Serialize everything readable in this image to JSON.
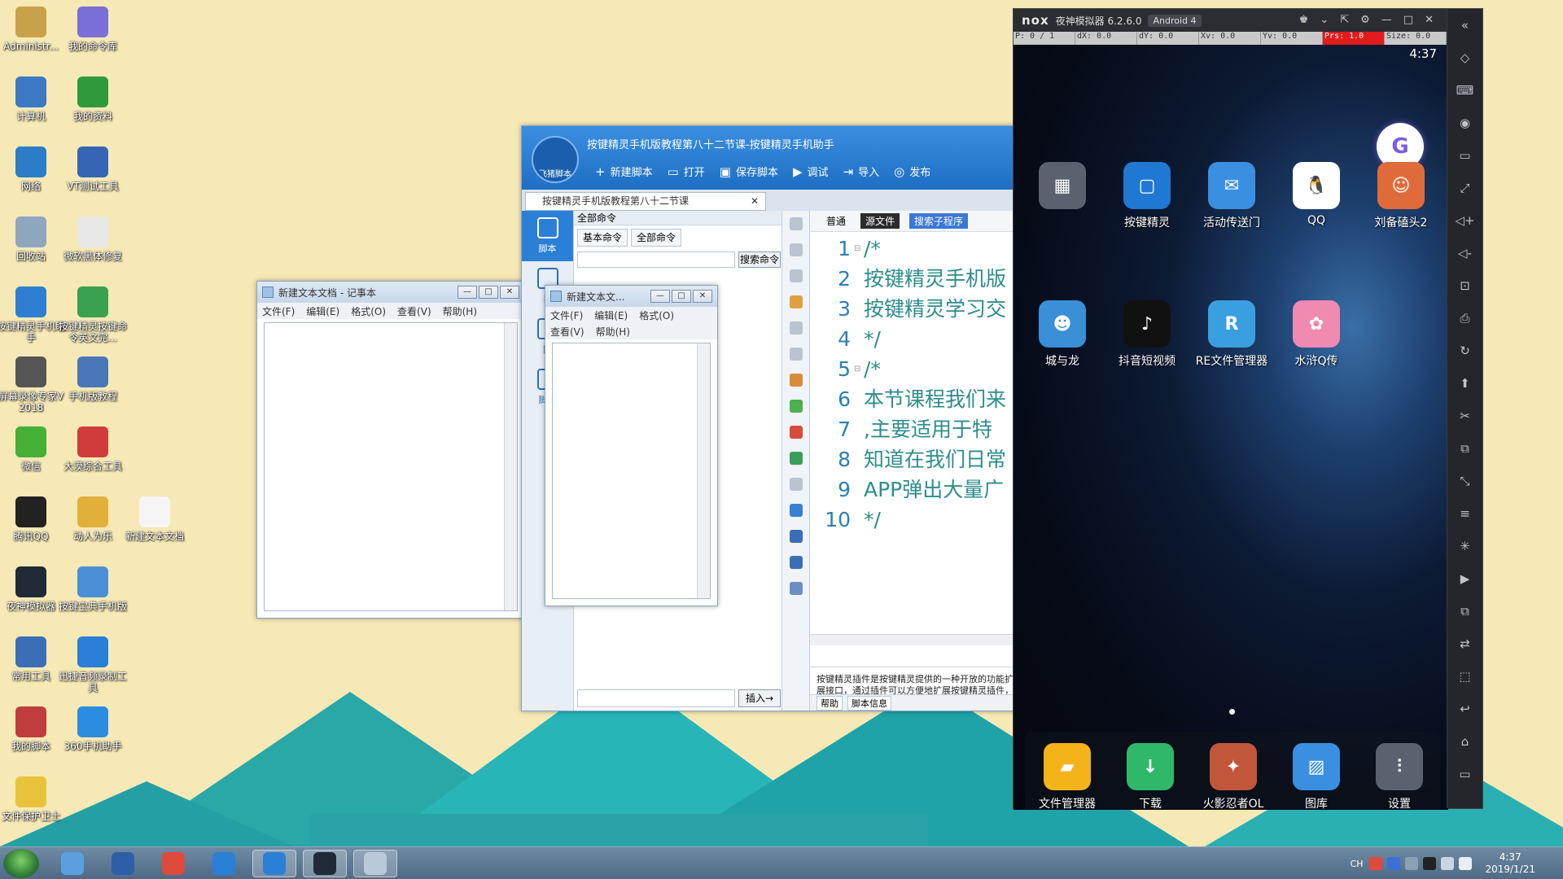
{
  "desktop": {
    "icons": [
      {
        "label": "Administr...",
        "color": "#c9a14a"
      },
      {
        "label": "我的命令库",
        "color": "#7a6fd6"
      },
      {
        "label": "计算机",
        "color": "#3d79c5"
      },
      {
        "label": "我的资料",
        "color": "#2f9a3b"
      },
      {
        "label": "网络",
        "color": "#2b7cc9"
      },
      {
        "label": "VT测试工具",
        "color": "#3566b5"
      },
      {
        "label": "回收站",
        "color": "#8fa6bf"
      },
      {
        "label": "微软黑体修复",
        "color": "#e8e8e8"
      },
      {
        "label": "按键精灵手机助手",
        "color": "#2e7fd1"
      },
      {
        "label": "按键精灵按键命令英文完...",
        "color": "#3aa14f"
      },
      {
        "label": "屏幕录像专家V2018",
        "color": "#555555"
      },
      {
        "label": "手机版教程",
        "color": "#4a77b8"
      },
      {
        "label": "微信",
        "color": "#45b035"
      },
      {
        "label": "大漠综合工具",
        "color": "#d23b3b"
      },
      {
        "label": "腾讯QQ",
        "color": "#222222"
      },
      {
        "label": "动人为乐",
        "color": "#e0b03a"
      },
      {
        "label": "新建文本文档",
        "color": "#f5f5f5"
      },
      {
        "label": "夜神模拟器",
        "color": "#1f2a36"
      },
      {
        "label": "按键宝典手机版",
        "color": "#4a8fd6"
      },
      {
        "label": "常用工具",
        "color": "#3a6fb7"
      },
      {
        "label": "迅捷音频录制工具",
        "color": "#2a7fd6"
      },
      {
        "label": "我的脚本",
        "color": "#c03d3d"
      },
      {
        "label": "360手机助手",
        "color": "#2b8ce0"
      },
      {
        "label": "文件保护卫士",
        "color": "#e8c23a"
      }
    ]
  },
  "notepad1": {
    "title": "新建文本文档 - 记事本",
    "menu": [
      "文件(F)",
      "编辑(E)",
      "格式(O)",
      "查看(V)",
      "帮助(H)"
    ],
    "min": "—",
    "max": "□",
    "close": "✕"
  },
  "notepad2": {
    "title": "新建文本文...",
    "menu_row1": [
      "文件(F)",
      "编辑(E)",
      "格式(O)"
    ],
    "menu_row2": [
      "查看(V)",
      "帮助(H)"
    ],
    "min": "—",
    "max": "□",
    "close": "✕"
  },
  "anjian": {
    "title": "按键精灵手机版教程第八十二节课-按键精灵手机助手",
    "logo_label": "飞猪脚本",
    "toolbar": [
      {
        "icon": "+",
        "label": "新建脚本"
      },
      {
        "icon": "▭",
        "label": "打开"
      },
      {
        "icon": "▣",
        "label": "保存脚本"
      },
      {
        "icon": "▶",
        "label": "调试"
      },
      {
        "icon": "⇥",
        "label": "导入"
      },
      {
        "icon": "◎",
        "label": "发布"
      }
    ],
    "doc_tab": "按键精灵手机版教程第八十二节课",
    "doc_tab_close": "✕",
    "side": [
      {
        "label": "脚本",
        "active": true
      },
      {
        "label": "界",
        "active": false
      },
      {
        "label": "附",
        "active": false
      },
      {
        "label": "脚本",
        "active": false
      }
    ],
    "cmd_header": "全部命令",
    "cmd_tabs": [
      "基本命令",
      "全部命令"
    ],
    "search_btn": "搜索命令",
    "insert_btn": "插入→",
    "editor_tabs": {
      "normal": "普通",
      "source": "源文件",
      "search": "搜索子程序"
    },
    "code_lines": [
      {
        "n": "1",
        "fold": "⊟",
        "text": "/*"
      },
      {
        "n": "2",
        "fold": "",
        "text": "按键精灵手机版"
      },
      {
        "n": "3",
        "fold": "",
        "text": "按键精灵学习交"
      },
      {
        "n": "4",
        "fold": "",
        "text": "*/"
      },
      {
        "n": "5",
        "fold": "⊟",
        "text": "/*"
      },
      {
        "n": "6",
        "fold": "",
        "text": "本节课程我们来"
      },
      {
        "n": "7",
        "fold": "",
        "text": ",主要适用于特"
      },
      {
        "n": "8",
        "fold": "",
        "text": "知道在我们日常"
      },
      {
        "n": "9",
        "fold": "",
        "text": "APP弹出大量广"
      },
      {
        "n": "10",
        "fold": "",
        "text": "*/"
      }
    ],
    "help_text": "按键精灵插件是按键精灵提供的一种开放的功能扩展接口，通过插件可以方便地扩展按键精灵插件，实现比较特殊、高级的功能。按键精灵插件，在插件区域中列出，希望能得到大家共同分享您的智慧!",
    "bottom_tabs": [
      "帮助",
      "脚本信息"
    ]
  },
  "nox": {
    "logo": "nox",
    "title": "夜神模拟器 6.2.6.0",
    "android": "Android 4",
    "debug": [
      "P: 0 / 1",
      "dX: 0.0",
      "dY: 0.0",
      "Xv: 0.0",
      "Yv: 0.0",
      "Prs: 1.0",
      "Size: 0.0"
    ],
    "time": "4:37",
    "apps_row1": [
      {
        "label": "",
        "color": "#5a6270",
        "glyph": "▦"
      },
      {
        "label": "按键精灵",
        "color": "#1f78d1",
        "glyph": "▢"
      },
      {
        "label": "活动传送门",
        "color": "#3b8fe0",
        "glyph": "✉"
      },
      {
        "label": "QQ",
        "color": "#ffffff",
        "glyph": "🐧"
      },
      {
        "label": "刘备磕头2",
        "color": "#e06b3a",
        "glyph": "☺"
      }
    ],
    "apps_row2": [
      {
        "label": "城与龙",
        "color": "#3a8fd6",
        "glyph": "☻"
      },
      {
        "label": "抖音短视频",
        "color": "#111111",
        "glyph": "♪"
      },
      {
        "label": "RE文件管理器",
        "color": "#3a9fe0",
        "glyph": "R"
      },
      {
        "label": "水浒Q传",
        "color": "#f08ab0",
        "glyph": "✿"
      }
    ],
    "dock": [
      {
        "label": "文件管理器",
        "color": "#f5b31a",
        "glyph": "▰"
      },
      {
        "label": "下载",
        "color": "#2fb86a",
        "glyph": "↓"
      },
      {
        "label": "火影忍者OL",
        "color": "#c2563a",
        "glyph": "✦"
      },
      {
        "label": "图库",
        "color": "#3a8fe0",
        "glyph": "▨"
      },
      {
        "label": "设置",
        "color": "#5a6270",
        "glyph": "⫶"
      }
    ],
    "title_ctrls": [
      "♚",
      "⌄",
      "⇱",
      "⚙",
      "—",
      "□",
      "✕"
    ],
    "side_icons": [
      "«",
      "◇",
      "⌨",
      "◉",
      "▭",
      "⤢",
      "◁+",
      "◁-",
      "⊡",
      "⎙",
      "↻",
      "⬆",
      "✂",
      "⧉",
      "⤡",
      "≡",
      "✳",
      "▶",
      "⧉",
      "⇄",
      "⬚",
      "↩",
      "⌂",
      "▭"
    ]
  },
  "taskbar": {
    "apps": [
      {
        "color": "#5aa0e0",
        "active": false
      },
      {
        "color": "#2d5fa8",
        "active": false
      },
      {
        "color": "#e04a3a",
        "active": false
      },
      {
        "color": "#2a7fd6",
        "active": false
      },
      {
        "color": "#2a7fd6",
        "active": true
      },
      {
        "color": "#1f2a36",
        "active": true
      },
      {
        "color": "#b8cad8",
        "active": true
      }
    ],
    "lang": "CH",
    "time": "4:37",
    "date": "2019/1/21"
  }
}
